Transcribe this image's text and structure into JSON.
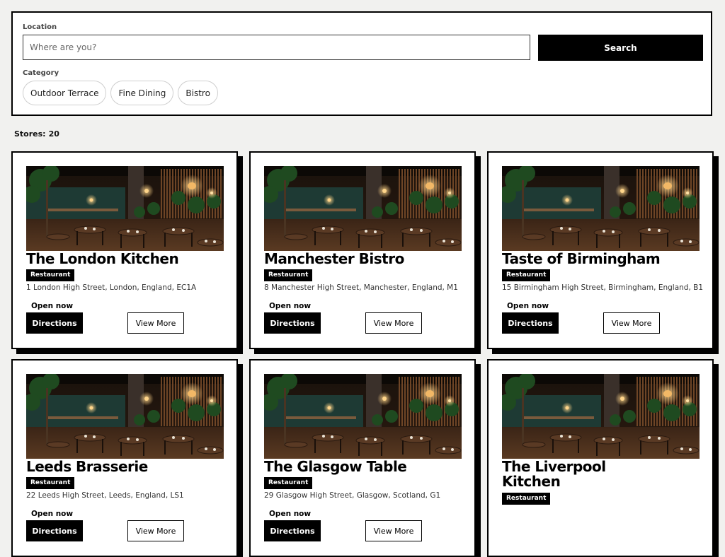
{
  "search": {
    "location_label": "Location",
    "location_placeholder": "Where are you?",
    "location_value": "",
    "search_button": "Search",
    "category_label": "Category",
    "categories": [
      "Outdoor Terrace",
      "Fine Dining",
      "Bistro"
    ]
  },
  "results": {
    "count_label": "Stores:",
    "count": "20"
  },
  "stores": [
    {
      "name": "The London Kitchen",
      "type": "Restaurant",
      "address": "1 London High Street, London, England, EC1A",
      "status": "Open now",
      "directions": "Directions",
      "more": "View More"
    },
    {
      "name": "Manchester Bistro",
      "type": "Restaurant",
      "address": "8 Manchester High Street, Manchester, England, M1",
      "status": "Open now",
      "directions": "Directions",
      "more": "View More"
    },
    {
      "name": "Taste of Birmingham",
      "type": "Restaurant",
      "address": "15 Birmingham High Street, Birmingham, England, B1",
      "status": "Open now",
      "directions": "Directions",
      "more": "View More"
    },
    {
      "name": "Leeds Brasserie",
      "type": "Restaurant",
      "address": "22 Leeds High Street, Leeds, England, LS1",
      "status": "Open now",
      "directions": "Directions",
      "more": "View More"
    },
    {
      "name": "The Glasgow Table",
      "type": "Restaurant",
      "address": "29 Glasgow High Street, Glasgow, Scotland, G1",
      "status": "Open now",
      "directions": "Directions",
      "more": "View More"
    },
    {
      "name": "The Liverpool Kitchen",
      "type": "Restaurant",
      "address": "",
      "status": "",
      "directions": "",
      "more": ""
    }
  ],
  "colors": {
    "accent": "#000000",
    "card_bg": "#ffffff",
    "page_bg": "#f1f1ef"
  }
}
